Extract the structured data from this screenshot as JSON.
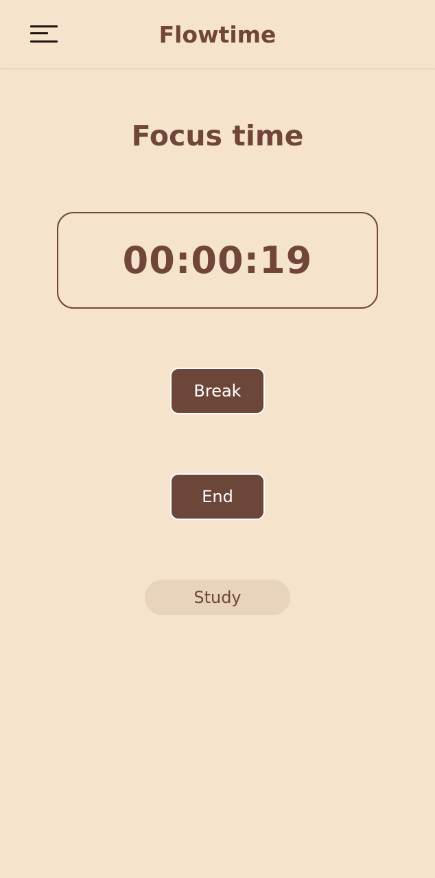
{
  "app": {
    "title": "Flowtime"
  },
  "header": {
    "menu_icon": "hamburger-menu-icon"
  },
  "main": {
    "mode_title": "Focus time",
    "timer": "00:00:19",
    "break_label": "Break",
    "end_label": "End",
    "category_label": "Study"
  },
  "colors": {
    "background": "#f6e3cb",
    "primary": "#6f4638",
    "button": "#6d463a",
    "chip": "#e8d3bd"
  }
}
